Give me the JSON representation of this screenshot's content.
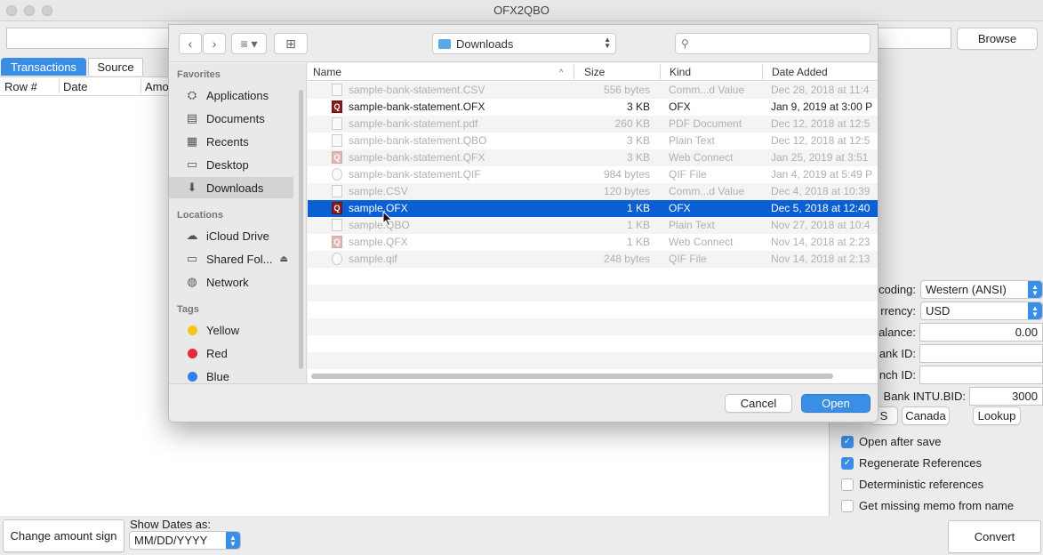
{
  "window": {
    "title": "OFX2QBO"
  },
  "top": {
    "browse_label": "Browse"
  },
  "tabs": [
    "Transactions",
    "Source"
  ],
  "table": {
    "columns": [
      "Row #",
      "Date",
      "Amo"
    ]
  },
  "settings": {
    "encoding_label": "coding:",
    "encoding_value": "Western (ANSI)",
    "currency_label": "rrency:",
    "currency_value": "USD",
    "balance_label": "alance:",
    "balance_value": "0.00",
    "bankid_label": "ank ID:",
    "branchid_label": "nch ID:",
    "intubid_label": "Bank INTU.BID:",
    "intubid_value": "3000",
    "us_label": "S",
    "canada_label": "Canada",
    "lookup_label": "Lookup"
  },
  "options": [
    {
      "label": "Open after save",
      "checked": true
    },
    {
      "label": "Regenerate References",
      "checked": true
    },
    {
      "label": "Deterministic references",
      "checked": false
    },
    {
      "label": "Get missing memo from name",
      "checked": false
    }
  ],
  "bottom": {
    "change_sign_label": "Change amount sign",
    "show_dates_label": "Show Dates as:",
    "date_format_value": "MM/DD/YYYY",
    "convert_label": "Convert"
  },
  "dialog": {
    "location_label": "Downloads",
    "search_placeholder": "",
    "sidebar": {
      "favorites_heading": "Favorites",
      "favorites": [
        "Applications",
        "Documents",
        "Recents",
        "Desktop",
        "Downloads"
      ],
      "locations_heading": "Locations",
      "locations": [
        "iCloud Drive",
        "Shared Fol...",
        "Network"
      ],
      "tags_heading": "Tags",
      "tags": [
        {
          "name": "Yellow",
          "color": "#f5c518"
        },
        {
          "name": "Red",
          "color": "#e8283b"
        },
        {
          "name": "Blue",
          "color": "#2f7ff0"
        }
      ]
    },
    "columns": [
      "Name",
      "Size",
      "Kind",
      "Date Added"
    ],
    "files": [
      {
        "name": "sample-bank-statement.CSV",
        "size": "556 bytes",
        "kind": "Comm...d Value",
        "date": "Dec 28, 2018 at 11:4"
      },
      {
        "name": "sample-bank-statement.OFX",
        "size": "3 KB",
        "kind": "OFX",
        "date": "Jan 9, 2019 at 3:00 P"
      },
      {
        "name": "sample-bank-statement.pdf",
        "size": "260 KB",
        "kind": "PDF Document",
        "date": "Dec 12, 2018 at 12:5"
      },
      {
        "name": "sample-bank-statement.QBO",
        "size": "3 KB",
        "kind": "Plain Text",
        "date": "Dec 12, 2018 at 12:5"
      },
      {
        "name": "sample-bank-statement.QFX",
        "size": "3 KB",
        "kind": "Web Connect",
        "date": "Jan 25, 2019 at 3:51"
      },
      {
        "name": "sample-bank-statement.QIF",
        "size": "984 bytes",
        "kind": "QIF File",
        "date": "Jan 4, 2019 at 5:49 P"
      },
      {
        "name": "sample.CSV",
        "size": "120 bytes",
        "kind": "Comm...d Value",
        "date": "Dec 4, 2018 at 10:39"
      },
      {
        "name": "sample.OFX",
        "size": "1 KB",
        "kind": "OFX",
        "date": "Dec 5, 2018 at 12:40"
      },
      {
        "name": "sample.QBO",
        "size": "1 KB",
        "kind": "Plain Text",
        "date": "Nov 27, 2018 at 10:4"
      },
      {
        "name": "sample.QFX",
        "size": "1 KB",
        "kind": "Web Connect",
        "date": "Nov 14, 2018 at 2:23"
      },
      {
        "name": "sample.qif",
        "size": "248 bytes",
        "kind": "QIF File",
        "date": "Nov 14, 2018 at 2:13"
      }
    ],
    "cancel_label": "Cancel",
    "open_label": "Open"
  },
  "colors": {
    "accent": "#3a8ee6",
    "selection": "#0a5fd4"
  }
}
